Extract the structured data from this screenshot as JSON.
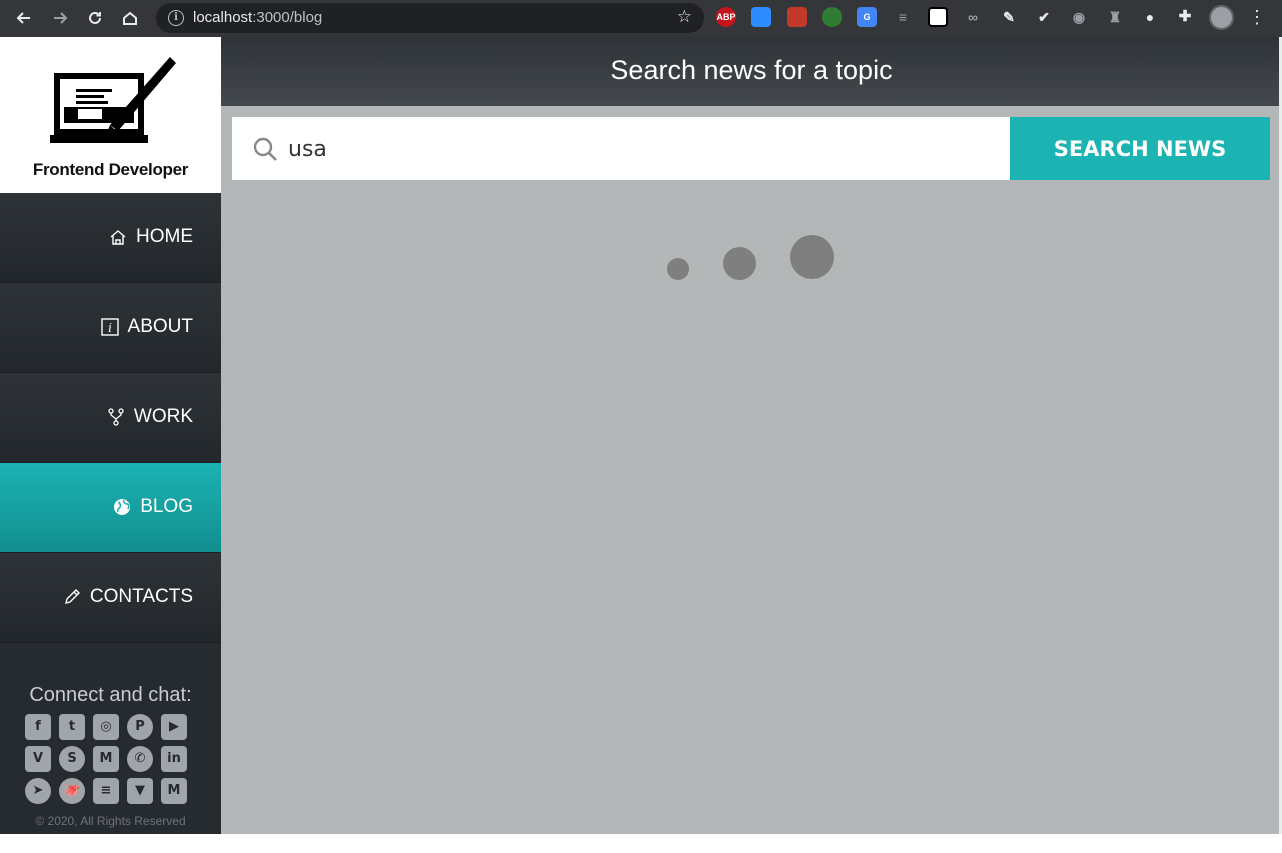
{
  "browser": {
    "url_host": "localhost",
    "url_path": ":3000/blog",
    "extensions": [
      {
        "icon": "adblock-icon",
        "text": "ABP",
        "color": "#c5161d"
      },
      {
        "icon": "zoom-icon",
        "text": "",
        "color": "#2d8cff"
      },
      {
        "icon": "red-extension-icon",
        "text": "",
        "color": "#c0392b"
      },
      {
        "icon": "green-circle-icon",
        "text": "",
        "color": "#2e7d32"
      },
      {
        "icon": "translate-icon",
        "text": "G",
        "color": "#4285f4"
      }
    ]
  },
  "logo": {
    "caption": "Frontend Developer"
  },
  "nav": {
    "items": [
      {
        "label": "HOME",
        "icon": "home-icon",
        "active": false
      },
      {
        "label": "ABOUT",
        "icon": "info-icon",
        "active": false
      },
      {
        "label": "WORK",
        "icon": "fork-icon",
        "active": false
      },
      {
        "label": "BLOG",
        "icon": "globe-icon",
        "active": true
      },
      {
        "label": "CONTACTS",
        "icon": "pencil-icon",
        "active": false
      }
    ]
  },
  "connect": {
    "title": "Connect and chat:",
    "socials": [
      {
        "icon": "facebook-icon",
        "glyph": "f"
      },
      {
        "icon": "twitter-icon",
        "glyph": "t"
      },
      {
        "icon": "instagram-icon",
        "glyph": "◎"
      },
      {
        "icon": "pinterest-icon",
        "glyph": "P"
      },
      {
        "icon": "youtube-icon",
        "glyph": "▶"
      },
      {
        "icon": "vimeo-icon",
        "glyph": "V"
      },
      {
        "icon": "skype-icon",
        "glyph": "S"
      },
      {
        "icon": "gmail-icon",
        "glyph": "M"
      },
      {
        "icon": "whatsapp-icon",
        "glyph": "✆"
      },
      {
        "icon": "linkedin-icon",
        "glyph": "in"
      },
      {
        "icon": "telegram-icon",
        "glyph": "➤"
      },
      {
        "icon": "github-icon",
        "glyph": "🐙"
      },
      {
        "icon": "stackoverflow-icon",
        "glyph": "≡"
      },
      {
        "icon": "bitbucket-icon",
        "glyph": "▼"
      },
      {
        "icon": "medium-icon",
        "glyph": "M"
      }
    ],
    "copyright": "© 2020, All Rights Reserved"
  },
  "main": {
    "title": "Search news for a topic",
    "search_value": "usa",
    "search_button": "SEARCH NEWS"
  },
  "colors": {
    "accent": "#1cb3b3",
    "sidebar": "#262b30",
    "content_bg": "#b4b7b8"
  }
}
